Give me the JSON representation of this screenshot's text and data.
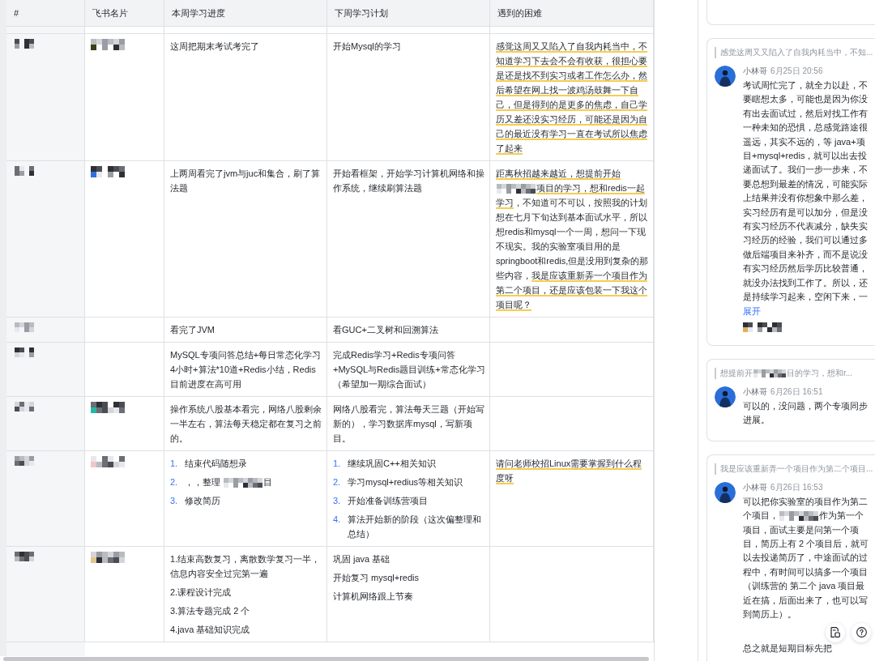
{
  "table": {
    "columns": [
      {
        "label": "#"
      },
      {
        "label": "飞书名片"
      },
      {
        "label": "本周学习进度"
      },
      {
        "label": "下周学习计划"
      },
      {
        "label": "遇到的困难"
      }
    ],
    "rows": [
      {
        "name_redacted": true,
        "card_redacted": true,
        "progress": [
          {
            "kind": "paragraph",
            "segments": [
              {
                "kind": "text",
                "text": "这周把期末考试考完了",
                "highlighted": false
              }
            ]
          }
        ],
        "plan": [
          {
            "kind": "paragraph",
            "segments": [
              {
                "kind": "text",
                "text": "开始Mysql的学习",
                "highlighted": false
              }
            ]
          }
        ],
        "difficulty": [
          {
            "kind": "paragraph",
            "segments": [
              {
                "kind": "text",
                "text": "感觉这周又又陷入了自我内耗当中，不知道学习下去会不会有收获，很担心要是还是找不到实习或者工作怎么办，然后希望在网上找一波鸡汤鼓舞一下自己，但是得到的是更多的焦虑，自己学历又差还没实习经历，可能还是因为自己的最近没有学习一直在考试所以焦虑了起来",
                "highlighted": true
              }
            ]
          }
        ]
      },
      {
        "name_redacted": true,
        "card_redacted": true,
        "progress": [
          {
            "kind": "paragraph",
            "segments": [
              {
                "kind": "text",
                "text": "上两周看完了jvm与juc和集合，刷了算法题",
                "highlighted": false
              }
            ]
          }
        ],
        "plan": [
          {
            "kind": "paragraph",
            "segments": [
              {
                "kind": "text",
                "text": "开始看框架，开始学习计算机网络和操作系统，继续刷算法题",
                "highlighted": false
              }
            ]
          }
        ],
        "difficulty": [
          {
            "kind": "paragraph",
            "segments": [
              {
                "kind": "text",
                "text": "距离秋招越来越近，想提前开始",
                "highlighted": true
              },
              {
                "kind": "redacted"
              },
              {
                "kind": "text",
                "text": "项目的学习，想和redis一起学习",
                "highlighted": true
              },
              {
                "kind": "text",
                "text": "，不知道可不可以，按照我的计划想在七月下旬达到基本面试水平，所以想redis和mysql一个一周，想问一下现不现实。我的实验室项目用的是springboot和redis,但是没用到复杂的那些内容，",
                "highlighted": false
              },
              {
                "kind": "text",
                "text": "我是应该重新弄一个项目作为第二个项目，还是应该包装一下我这个项目呢？",
                "highlighted": true
              }
            ]
          }
        ]
      },
      {
        "name_redacted": true,
        "card_redacted": false,
        "progress": [
          {
            "kind": "paragraph",
            "segments": [
              {
                "kind": "text",
                "text": "看完了JVM",
                "highlighted": false
              }
            ]
          }
        ],
        "plan": [
          {
            "kind": "paragraph",
            "segments": [
              {
                "kind": "text",
                "text": "看GUC+二叉树和回溯算法",
                "highlighted": false
              }
            ]
          }
        ]
      },
      {
        "name_redacted": true,
        "card_redacted": false,
        "progress": [
          {
            "kind": "paragraph",
            "segments": [
              {
                "kind": "text",
                "text": "MySQL专项问答总结+每日常态化学习4小时+算法*10道+Redis小结，Redis目前进度在高可用",
                "highlighted": false
              }
            ]
          }
        ],
        "plan": [
          {
            "kind": "paragraph",
            "segments": [
              {
                "kind": "text",
                "text": "完成Redis学习+Redis专项问答+MySQL与Redis题目训练+常态化学习（希望加一期综合面试）",
                "highlighted": false
              }
            ]
          }
        ]
      },
      {
        "name_redacted": true,
        "card_redacted": true,
        "progress": [
          {
            "kind": "paragraph",
            "segments": [
              {
                "kind": "text",
                "text": "操作系统八股基本看完，网络八股剩余一半左右，算法每天稳定都在复习之前的。",
                "highlighted": false
              }
            ]
          }
        ],
        "plan": [
          {
            "kind": "paragraph",
            "segments": [
              {
                "kind": "text",
                "text": "网络八股看完，算法每天三题（开始写新的），学习数据库mysql，写新项目。",
                "highlighted": false
              }
            ]
          }
        ]
      },
      {
        "name_redacted": true,
        "card_redacted": true,
        "progress": [
          {
            "kind": "list_item",
            "number": "1.",
            "segments": [
              {
                "kind": "text",
                "text": "结束代码随想录",
                "highlighted": false
              }
            ]
          },
          {
            "kind": "list_item",
            "number": "2.",
            "segments": [
              {
                "kind": "text",
                "text": "，，整理 ",
                "highlighted": false
              },
              {
                "kind": "redacted"
              },
              {
                "kind": "text",
                "text": "目",
                "highlighted": false
              }
            ]
          },
          {
            "kind": "list_item",
            "number": "3.",
            "segments": [
              {
                "kind": "text",
                "text": "修改简历",
                "highlighted": false
              }
            ]
          }
        ],
        "plan": [
          {
            "kind": "list_item",
            "number": "1.",
            "segments": [
              {
                "kind": "text",
                "text": "继续巩固C++相关知识",
                "highlighted": false
              }
            ]
          },
          {
            "kind": "list_item",
            "number": "2.",
            "segments": [
              {
                "kind": "text",
                "text": "学习mysql+redius等相关知识",
                "highlighted": false
              }
            ]
          },
          {
            "kind": "list_item",
            "number": "3.",
            "segments": [
              {
                "kind": "text",
                "text": "开始准备训练营项目",
                "highlighted": false
              }
            ]
          },
          {
            "kind": "list_item",
            "number": "4.",
            "segments": [
              {
                "kind": "text",
                "text": "算法开始新的阶段（这次偏整理和总结）",
                "highlighted": false
              }
            ]
          }
        ],
        "difficulty": [
          {
            "kind": "paragraph",
            "segments": [
              {
                "kind": "text",
                "text": "请问老师校招Linux需要掌握到什么程度呀",
                "highlighted": true
              }
            ]
          }
        ]
      },
      {
        "name_redacted": true,
        "card_redacted": true,
        "progress": [
          {
            "kind": "paragraph",
            "segments": [
              {
                "kind": "text",
                "text": "1.结束高数复习，离散数学复习一半，信息内容安全过完第一遍",
                "highlighted": false
              }
            ]
          },
          {
            "kind": "paragraph",
            "segments": [
              {
                "kind": "text",
                "text": "2.课程设计完成",
                "highlighted": false
              }
            ]
          },
          {
            "kind": "paragraph",
            "segments": [
              {
                "kind": "text",
                "text": "3.算法专题完成 2 个",
                "highlighted": false
              }
            ]
          },
          {
            "kind": "paragraph",
            "segments": [
              {
                "kind": "text",
                "text": "4.java 基础知识完成",
                "highlighted": false
              }
            ]
          }
        ],
        "plan": [
          {
            "kind": "paragraph",
            "segments": [
              {
                "kind": "text",
                "text": "巩固 java 基础",
                "highlighted": false
              }
            ]
          },
          {
            "kind": "paragraph",
            "segments": [
              {
                "kind": "text",
                "text": "开始复习 mysql+redis",
                "highlighted": false
              }
            ]
          },
          {
            "kind": "paragraph",
            "segments": [
              {
                "kind": "text",
                "text": "计算机网络跟上节奏",
                "highlighted": false
              }
            ]
          }
        ]
      }
    ]
  },
  "comments": {
    "items": [
      {
        "quote": [
          {
            "kind": "text",
            "text": "感觉这周又又陷入了自我内耗当中，不知..."
          }
        ],
        "author": "小林哥",
        "time": "6月25日 20:56",
        "body": [
          [
            {
              "kind": "text",
              "text": "考试周忙完了，就全力以赴，不要瞎想太多，可能也是因为你没有出去面试过，然后对找工作有一种未知的恐惧，总感觉路途很遥远，其实不远的，等 java+项目+mysql+redis，就可以出去投递面试了。我们一步一步来，不要总想到最差的情况，可能实际上结果并没有你想象中那么差，实习经历有是可以加分，但是没有实习经历不代表减分，缺失实习经历的经验，我们可以通过多做后端项目来补齐，而不是说没有实习经历然后学历比较普通，就没办法找到工作了。所以，还是持续学习起来，空闲下来，一"
            }
          ]
        ],
        "expand_link": "展开",
        "reactions_redacted": true
      },
      {
        "quote": [
          {
            "kind": "text",
            "text": "想提前开"
          },
          {
            "kind": "redacted"
          },
          {
            "kind": "text",
            "text": "目的学习，想和r..."
          }
        ],
        "author": "小林哥",
        "time": "6月26日 16:51",
        "body": [
          [
            {
              "kind": "text",
              "text": "可以的，没问题，两个专项同步进展。"
            }
          ]
        ],
        "reactions_redacted": false
      },
      {
        "quote": [
          {
            "kind": "text",
            "text": "我是应该重新弄一个项目作为第二个项目..."
          }
        ],
        "author": "小林哥",
        "time": "6月26日 16:53",
        "body": [
          [
            {
              "kind": "text",
              "text": "可以把你实验室的项目作为第二个项目，"
            },
            {
              "kind": "redacted"
            },
            {
              "kind": "text",
              "text": "作为第一个项目，面试主要是问第一个项目，简历上有 2 个项目后，就可以去投递简历了，中途面试的过程中，有时间可以搞多一个项目（训练营的 第二个 java 项目最近在搞，后面出来了，也可以写到简历上）。"
            }
          ],
          [
            {
              "kind": "text",
              "text": "总之就是短期目标先把"
            }
          ]
        ],
        "reactions_redacted": false
      }
    ]
  }
}
